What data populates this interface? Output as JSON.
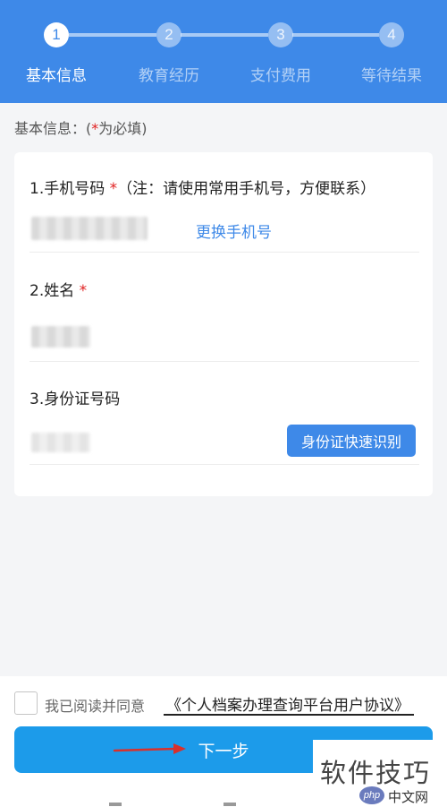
{
  "stepper": {
    "steps": [
      {
        "number": "1",
        "label": "基本信息",
        "active": true
      },
      {
        "number": "2",
        "label": "教育经历",
        "active": false
      },
      {
        "number": "3",
        "label": "支付费用",
        "active": false
      },
      {
        "number": "4",
        "label": "等待结果",
        "active": false
      }
    ]
  },
  "section_hint": {
    "prefix": "基本信息：(",
    "required_mark": "*",
    "suffix": "为必填)"
  },
  "form": {
    "phone": {
      "label": "1.手机号码",
      "required_mark": "*",
      "note": "（注：请使用常用手机号，方便联系）",
      "change_link": "更换手机号"
    },
    "name": {
      "label": "2.姓名",
      "required_mark": "*"
    },
    "id_number": {
      "label": "3.身份证号码",
      "quick_scan_button": "身份证快速识别"
    }
  },
  "agreement": {
    "text": "我已阅读并同意",
    "link": "《个人档案办理查询平台用户协议》",
    "checked": false
  },
  "next_button": "下一步",
  "watermark": {
    "main": "软件技巧",
    "php": "php",
    "cn": "中文网"
  },
  "colors": {
    "header": "#3e89e8",
    "primary_button": "#1c9bea",
    "required": "#e02020",
    "arrow": "#d9302b"
  }
}
